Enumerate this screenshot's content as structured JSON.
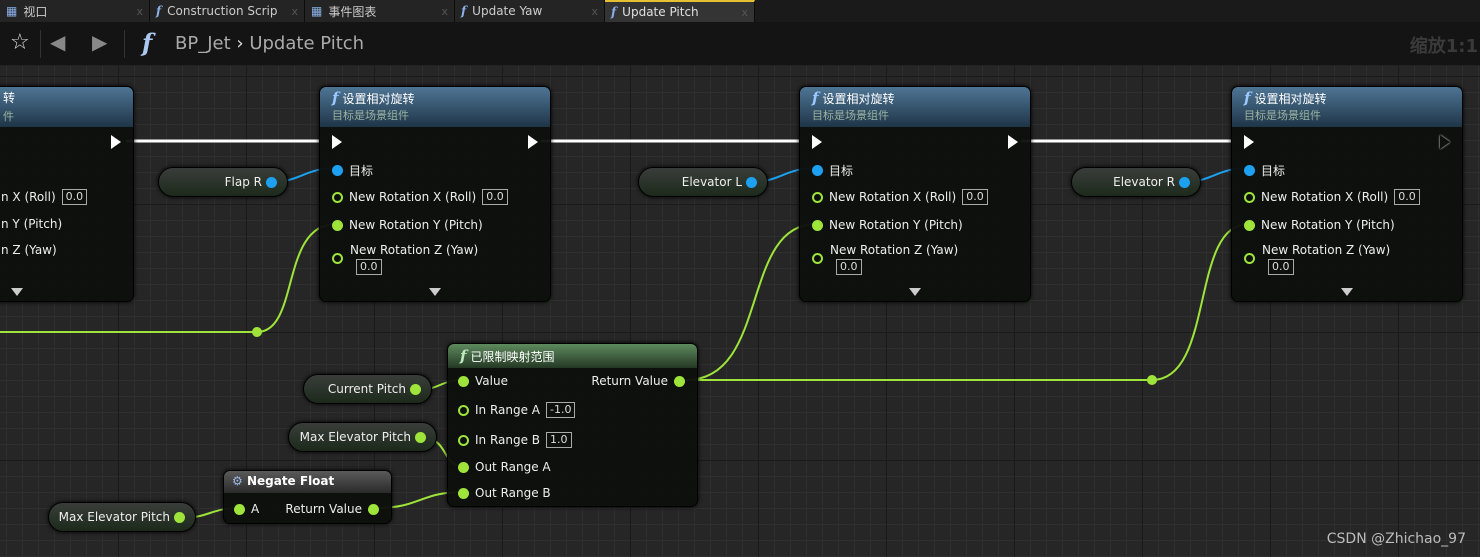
{
  "tabs": [
    {
      "label": "视口",
      "icon": "viewport-icon"
    },
    {
      "label": "Construction Scrip",
      "icon": "function-icon"
    },
    {
      "label": "事件图表",
      "icon": "event-graph-icon"
    },
    {
      "label": "Update Yaw",
      "icon": "function-icon"
    },
    {
      "label": "Update Pitch",
      "icon": "function-icon",
      "active": true
    }
  ],
  "breadcrumb": {
    "blueprint": "BP_Jet",
    "separator": "›",
    "function": "Update Pitch"
  },
  "zoom_label": "缩放1:1",
  "watermark": "CSDN @Zhichao_97",
  "set_rotation_nodes": [
    {
      "title": "设置相对旋转",
      "subtitle": "目标是场景组件",
      "target": "目标",
      "x_label": "New Rotation X (Roll)",
      "x_value": "0.0",
      "y_label": "New Rotation Y (Pitch)",
      "z_label": "New Rotation Z (Yaw)",
      "z_value": "0.0"
    },
    {
      "title": "设置相对旋转",
      "subtitle": "目标是场景组件",
      "target": "目标",
      "x_label": "New Rotation X (Roll)",
      "x_value": "0.0",
      "y_label": "New Rotation Y (Pitch)",
      "z_label": "New Rotation Z (Yaw)",
      "z_value": "0.0"
    },
    {
      "title": "设置相对旋转",
      "subtitle": "目标是场景组件",
      "target": "目标",
      "x_label": "New Rotation X (Roll)",
      "x_value": "0.0",
      "y_label": "New Rotation Y (Pitch)",
      "z_label": "New Rotation Z (Yaw)",
      "z_value": "0.0"
    }
  ],
  "left_partial_node": {
    "title": "转",
    "subtitle": "件",
    "x_label": "n X (Roll)",
    "x_value": "0.0",
    "y_label": "n Y (Pitch)",
    "z_label": "n Z (Yaw)"
  },
  "variables": {
    "flap_r": "Flap R",
    "elevator_l": "Elevator L",
    "elevator_r": "Elevator R",
    "current_pitch": "Current Pitch",
    "max_elevator_pitch": "Max Elevator Pitch"
  },
  "map_range": {
    "title": "已限制映射范围",
    "value": "Value",
    "return": "Return Value",
    "in_a": "In Range A",
    "in_a_value": "-1.0",
    "in_b": "In Range B",
    "in_b_value": "1.0",
    "out_a": "Out Range A",
    "out_b": "Out Range B"
  },
  "negate": {
    "title": "Negate Float",
    "a": "A",
    "return": "Return Value"
  },
  "colors": {
    "float_pin": "#9ee43a",
    "object_pin": "#1ea0f0",
    "exec": "#ffffff",
    "function_header": "#4e7595",
    "pure_header": "#3d6a3d"
  }
}
